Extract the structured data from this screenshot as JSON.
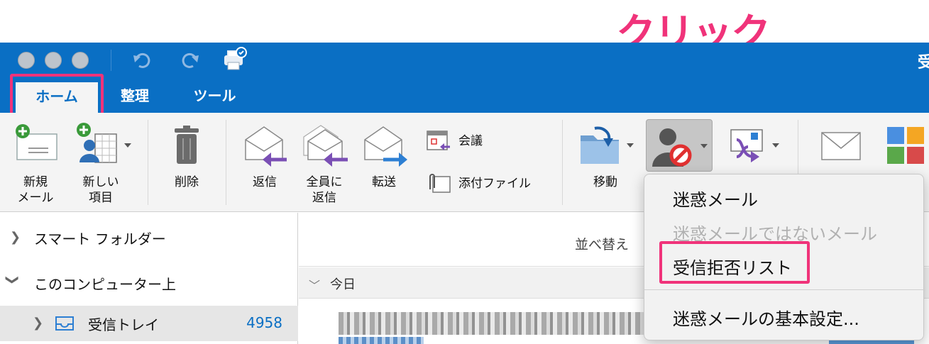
{
  "annotation": {
    "click_label": "クリック",
    "color": "#f0337a"
  },
  "window": {
    "title_fragment": "受"
  },
  "tabs": [
    {
      "label": "ホーム",
      "active": true
    },
    {
      "label": "整理",
      "active": false
    },
    {
      "label": "ツール",
      "active": false
    }
  ],
  "ribbon": {
    "new_mail": "新規\nメール",
    "new_item": "新しい\n項目",
    "delete": "削除",
    "reply": "返信",
    "reply_all": "全員に\n返信",
    "forward": "転送",
    "meeting": "会議",
    "attachment": "添付ファイル",
    "move": "移動"
  },
  "folders": {
    "smart_folders": "スマート フォルダー",
    "on_my_computer": "このコンピューター上",
    "inbox": "受信トレイ",
    "inbox_count": "4958"
  },
  "message_list": {
    "sort_label": "並べ替え",
    "group_today": "今日"
  },
  "junk_menu": {
    "items": [
      {
        "label": "迷惑メール",
        "enabled": true
      },
      {
        "label": "迷惑メールではないメール",
        "enabled": false
      },
      {
        "label": "受信拒否リスト",
        "enabled": true,
        "highlighted": true
      },
      {
        "label": "迷惑メールの基本設定...",
        "enabled": true
      }
    ]
  },
  "colors": {
    "brand_blue": "#0a6fc4",
    "ribbon_bg": "#f4f4f4",
    "highlight": "#f0337a"
  }
}
